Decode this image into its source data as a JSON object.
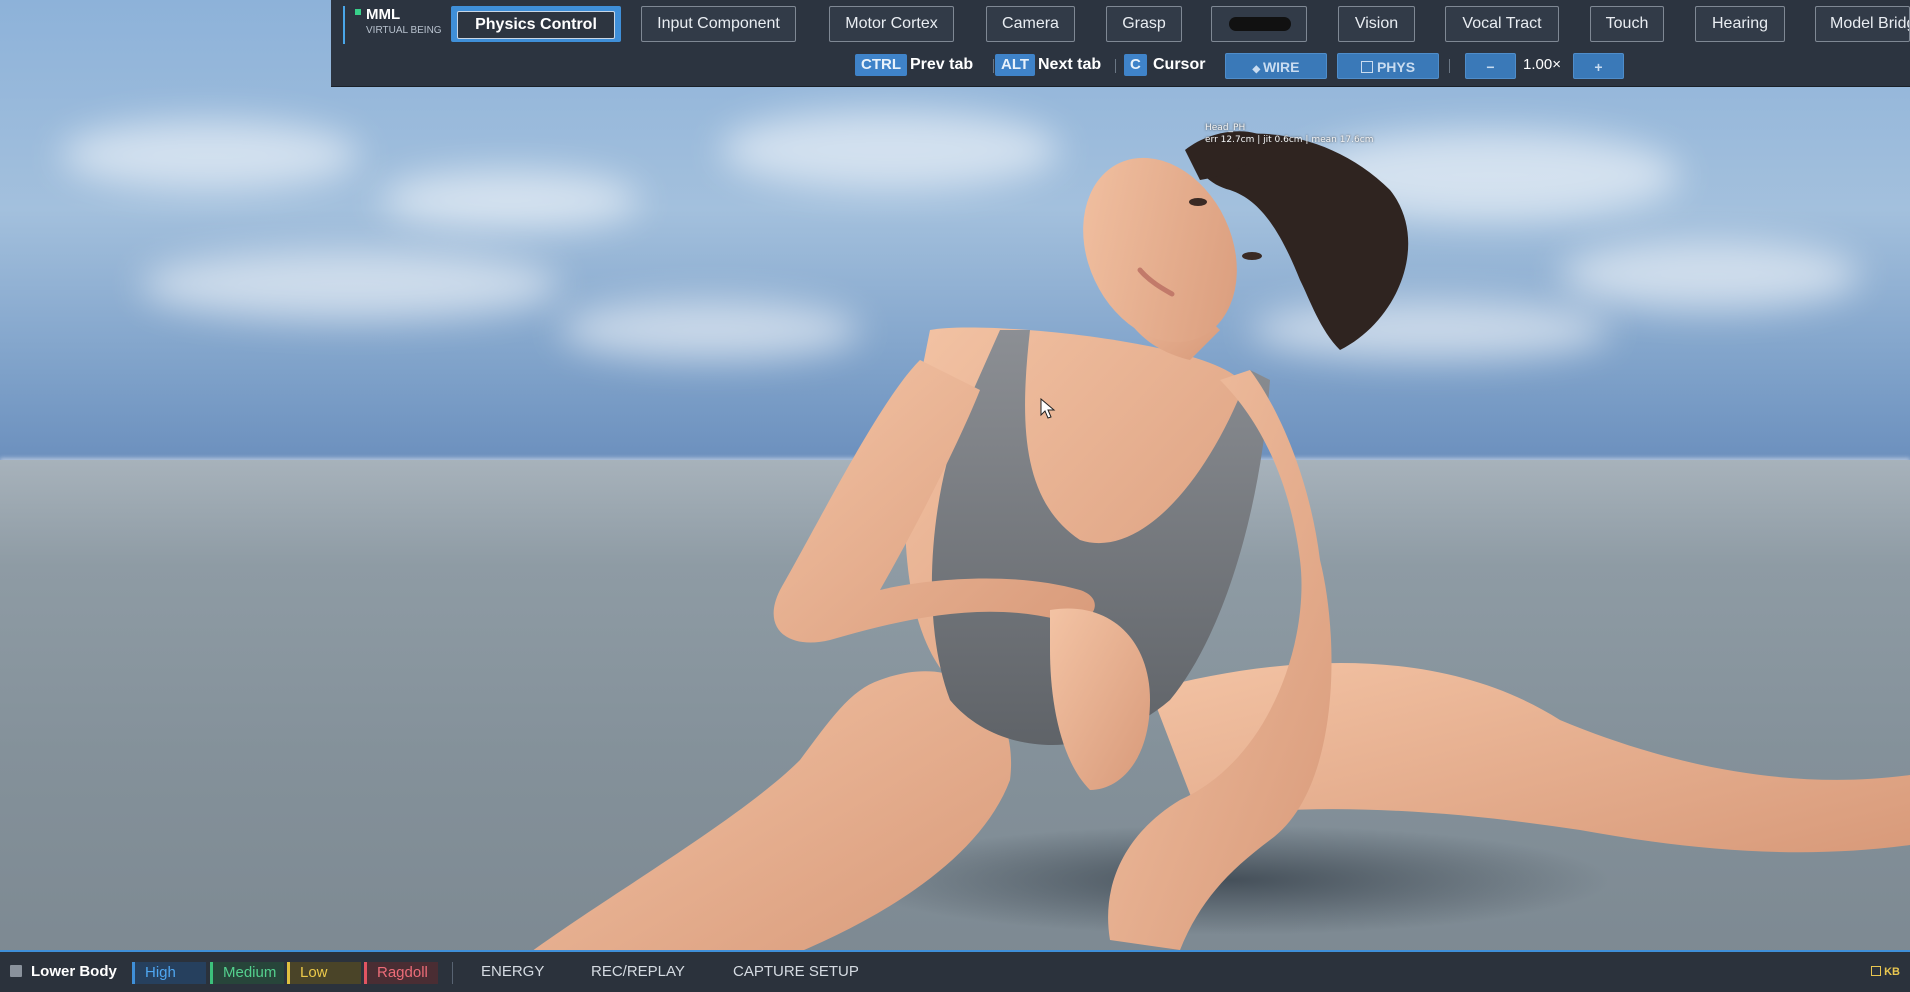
{
  "app": {
    "brand_title": "MML",
    "brand_subtitle": "VIRTUAL BEING"
  },
  "tabs": [
    {
      "label": "Physics Control",
      "active": true
    },
    {
      "label": "Input Component",
      "active": false
    },
    {
      "label": "Motor Cortex",
      "active": false
    },
    {
      "label": "Camera",
      "active": false
    },
    {
      "label": "Grasp",
      "active": false
    },
    {
      "label": "",
      "active": false,
      "redacted": true
    },
    {
      "label": "Vision",
      "active": false
    },
    {
      "label": "Vocal Tract",
      "active": false
    },
    {
      "label": "Touch",
      "active": false
    },
    {
      "label": "Hearing",
      "active": false
    },
    {
      "label": "Model Bridge",
      "active": false
    }
  ],
  "shortcuts": [
    {
      "key": "CTRL",
      "label": "Prev tab"
    },
    {
      "key": "ALT",
      "label": "Next tab"
    },
    {
      "key": "C",
      "label": "Cursor"
    }
  ],
  "toggles": {
    "wire_label": "WIRE",
    "phys_label": "PHYS"
  },
  "zoom": {
    "minus_label": "−",
    "value": "1.00×",
    "plus_label": "+"
  },
  "viewport": {
    "debug_title": "Head_PH",
    "debug_stats": "err 12.7cm | jit 0.6cm | mean 17.6cm"
  },
  "statusbar": {
    "checkbox_label": "Lower Body",
    "levels": [
      {
        "label": "High",
        "color": "#4fa6f0"
      },
      {
        "label": "Medium",
        "color": "#54d08e"
      },
      {
        "label": "Low",
        "color": "#ecc94a"
      },
      {
        "label": "Ragdoll",
        "color": "#ec6c78"
      }
    ],
    "links": [
      "ENERGY",
      "REC/REPLAY",
      "CAPTURE SETUP"
    ],
    "kb_label": "KB"
  },
  "colors": {
    "accent": "#3f8fd8",
    "toolbar_bg": "#2c3440"
  }
}
